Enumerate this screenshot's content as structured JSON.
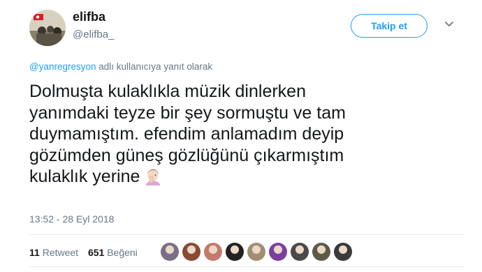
{
  "author": {
    "display_name": "elifba",
    "handle": "@elifba_"
  },
  "follow_button": {
    "label": "Takip et"
  },
  "reply_context": {
    "mention": "@yanregresyon",
    "suffix": " adlı kullanıcıya yanıt olarak"
  },
  "tweet": {
    "lines": [
      "Dolmuşta kulaklıkla müzik dinlerken",
      "yanımdaki teyze bir şey sormuştu ve tam",
      "duymamıştım. efendim anlamadım deyip",
      "gözümden güneş gözlüğünü çıkarmıştım",
      "kulaklık yerine"
    ],
    "emoji": "face-palm-woman-icon"
  },
  "timestamp": "13:52 - 28 Eyl 2018",
  "stats": {
    "retweets_count": "11",
    "retweets_label": "Retweet",
    "likes_count": "651",
    "likes_label": "Beğeni"
  },
  "likers": [
    {
      "name": "liker-avatar-1",
      "color": "#7a6f86"
    },
    {
      "name": "liker-avatar-2",
      "color": "#8a4a33"
    },
    {
      "name": "liker-avatar-3",
      "color": "#c47a6a"
    },
    {
      "name": "liker-avatar-4",
      "color": "#222222"
    },
    {
      "name": "liker-avatar-5",
      "color": "#a08f72"
    },
    {
      "name": "liker-avatar-6",
      "color": "#7b3fa0"
    },
    {
      "name": "liker-avatar-7",
      "color": "#4a4a4a"
    },
    {
      "name": "liker-avatar-8",
      "color": "#5d5a4a"
    },
    {
      "name": "liker-avatar-9",
      "color": "#3a3a3a"
    }
  ],
  "colors": {
    "accent": "#1da1f2",
    "text": "#14171a",
    "muted": "#657786",
    "divider": "#e6ecf0"
  }
}
